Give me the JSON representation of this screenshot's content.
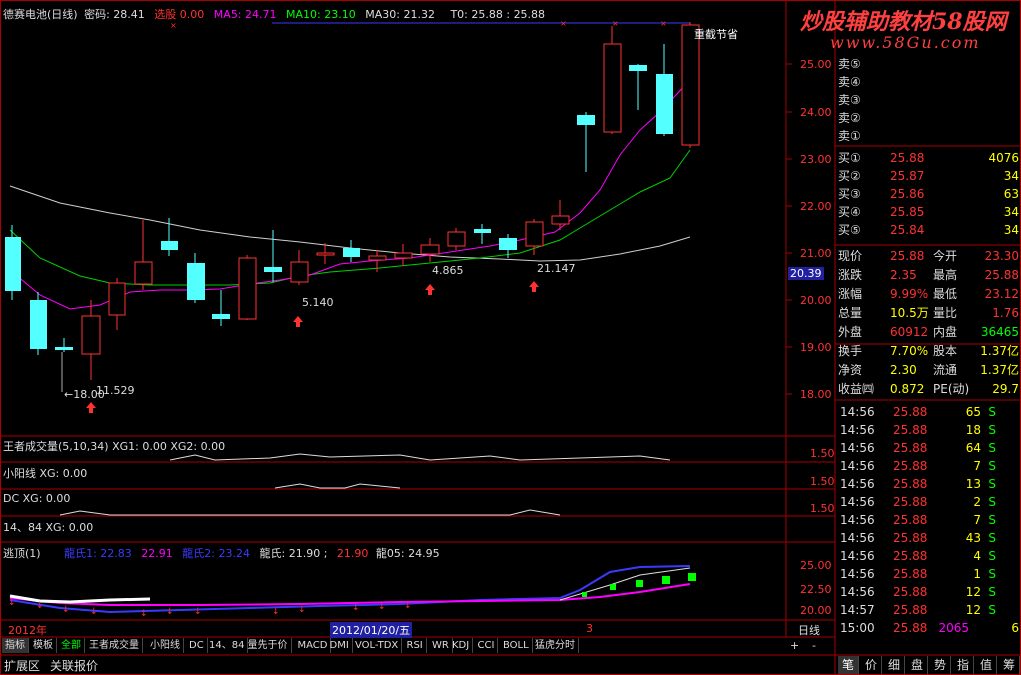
{
  "header": {
    "stock": "德赛电池(日线)",
    "code_label": "密码",
    "price_label": "密码: 28.41",
    "flag": "选股",
    "flag_val": "0.00",
    "ma5": "MA5: 24.71",
    "ma10": "MA10: 23.10",
    "ma30": "MA30: 21.32",
    "t0": "T0: 25.88 : 25.88"
  },
  "chart_annotations": {
    "note_top": "重截节省",
    "low_price": "←18.00",
    "low_label": "11.529",
    "mark1": "5.140",
    "mark2": "4.865",
    "mark3": "21.147",
    "cursor_price": "20.39"
  },
  "price_axis": [
    "25.00",
    "24.00",
    "23.00",
    "22.00",
    "21.00",
    "20.00",
    "19.00",
    "18.00"
  ],
  "indicators": [
    {
      "title": "王者成交量(5,10,34) XG1: 0.00 XG2: 0.00",
      "axis": "1.50"
    },
    {
      "title": "小阳线 XG: 0.00",
      "axis": "1.50"
    },
    {
      "title": "DC XG: 0.00",
      "axis": "1.50"
    },
    {
      "title": "14、84 XG: 0.00",
      "axis": ""
    }
  ],
  "escape_panel": {
    "title": "逃顶(1)",
    "v1_label": "龍氏1: 22.83",
    "v2": "22.91",
    "v3_label": "龍氏2: 23.24",
    "v4": "龍氏: 21.90 ;",
    "v5": "21.90",
    "v6": "龍05: 24.95",
    "axis": [
      "25.00",
      "22.50",
      "20.00"
    ]
  },
  "date_bar": {
    "year": "2012年",
    "date": "2012/01/20/五",
    "mark": "3",
    "period": "日线"
  },
  "tabs": [
    "指标",
    "模板",
    "全部",
    "王者成交量",
    "小阳线",
    "DC",
    "14、84",
    "量先于价",
    "MACD",
    "DMI",
    "VOL-TDX",
    "RSI",
    "WR",
    "KDJ",
    "CCI",
    "BOLL",
    "猛虎分时"
  ],
  "bottom_tabs": [
    "扩展区",
    "关联报价"
  ],
  "watermark": {
    "title": "炒股辅助教材58股网",
    "url": "www.58Gu.com"
  },
  "sell_orders": [
    "卖⑤",
    "卖④",
    "卖③",
    "卖②",
    "卖①"
  ],
  "buy_orders": [
    {
      "label": "买①",
      "price": "25.88",
      "vol": "4076"
    },
    {
      "label": "买②",
      "price": "25.87",
      "vol": "34"
    },
    {
      "label": "买③",
      "price": "25.86",
      "vol": "63"
    },
    {
      "label": "买④",
      "price": "25.85",
      "vol": "34"
    },
    {
      "label": "买⑤",
      "price": "25.84",
      "vol": "34"
    }
  ],
  "quote": [
    {
      "l1": "现价",
      "v1": "25.88",
      "l2": "今开",
      "v2": "23.30"
    },
    {
      "l1": "涨跌",
      "v1": "2.35",
      "l2": "最高",
      "v2": "25.88"
    },
    {
      "l1": "涨幅",
      "v1": "9.99%",
      "l2": "最低",
      "v2": "23.12"
    },
    {
      "l1": "总量",
      "v1": "10.5万",
      "l2": "量比",
      "v2": "1.76"
    },
    {
      "l1": "外盘",
      "v1": "60912",
      "l2": "内盘",
      "v2": "36465"
    },
    {
      "l1": "换手",
      "v1": "7.70%",
      "l2": "股本",
      "v2": "1.37亿"
    },
    {
      "l1": "净资",
      "v1": "2.30",
      "l2": "流通",
      "v2": "1.37亿"
    },
    {
      "l1": "收益㈣",
      "v1": "0.872",
      "l2": "PE(动)",
      "v2": "29.7"
    }
  ],
  "ticks": [
    {
      "t": "14:56",
      "p": "25.88",
      "v": "65",
      "s": "S"
    },
    {
      "t": "14:56",
      "p": "25.88",
      "v": "18",
      "s": "S"
    },
    {
      "t": "14:56",
      "p": "25.88",
      "v": "64",
      "s": "S"
    },
    {
      "t": "14:56",
      "p": "25.88",
      "v": "7",
      "s": "S"
    },
    {
      "t": "14:56",
      "p": "25.88",
      "v": "13",
      "s": "S"
    },
    {
      "t": "14:56",
      "p": "25.88",
      "v": "2",
      "s": "S"
    },
    {
      "t": "14:56",
      "p": "25.88",
      "v": "7",
      "s": "S"
    },
    {
      "t": "14:56",
      "p": "25.88",
      "v": "43",
      "s": "S"
    },
    {
      "t": "14:56",
      "p": "25.88",
      "v": "4",
      "s": "S"
    },
    {
      "t": "14:56",
      "p": "25.88",
      "v": "1",
      "s": "S"
    },
    {
      "t": "14:56",
      "p": "25.88",
      "v": "12",
      "s": "S"
    },
    {
      "t": "14:57",
      "p": "25.88",
      "v": "12",
      "s": "S"
    },
    {
      "t": "15:00",
      "p": "25.88",
      "v": "2065",
      "s": "6"
    }
  ],
  "right_tabs": [
    "笔",
    "价",
    "细",
    "盘",
    "势",
    "指",
    "值",
    "筹"
  ],
  "colors": {
    "up": "#ff3232",
    "down": "#54ffff",
    "ma5": "#ff00ff",
    "ma10": "#00ff00",
    "ma30": "#e0e0e0",
    "accent": "#ffff00"
  }
}
